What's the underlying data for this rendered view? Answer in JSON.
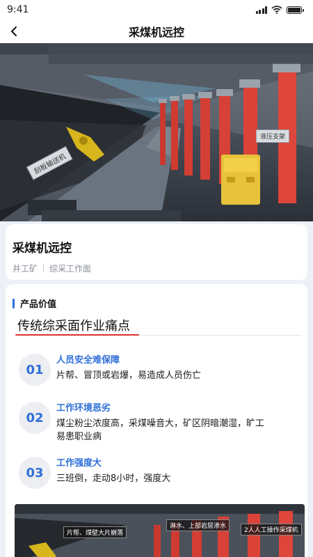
{
  "status_bar": {
    "time": "9:41"
  },
  "nav": {
    "title": "采煤机远控"
  },
  "hero": {
    "tags": [
      "刮板输送机",
      "液压支架"
    ]
  },
  "info": {
    "title": "采煤机远控",
    "meta": [
      "井工矿",
      "综采工作面"
    ]
  },
  "value": {
    "section_title": "产品价值",
    "pain_title": "传统综采面作业痛点",
    "items": [
      {
        "num": "01",
        "head": "人员安全难保障",
        "desc": "片帮、冒顶或岩爆，易造成人员伤亡"
      },
      {
        "num": "02",
        "head": "工作环境恶劣",
        "desc": "煤尘粉尘浓度高，采煤噪音大，矿区阴暗潮湿，旷工易患职业病"
      },
      {
        "num": "03",
        "head": "工作强度大",
        "desc": "三班倒，走动8小时，强度大"
      }
    ]
  },
  "bottom_image": {
    "labels": [
      "片帮、煤壁大片崩落",
      "淋水、上部岩层渗水",
      "2人人工操作采煤机"
    ]
  },
  "colors": {
    "accent": "#2f6fd8",
    "underline_red": "#d6332e",
    "page_bg": "#eef0f8"
  }
}
